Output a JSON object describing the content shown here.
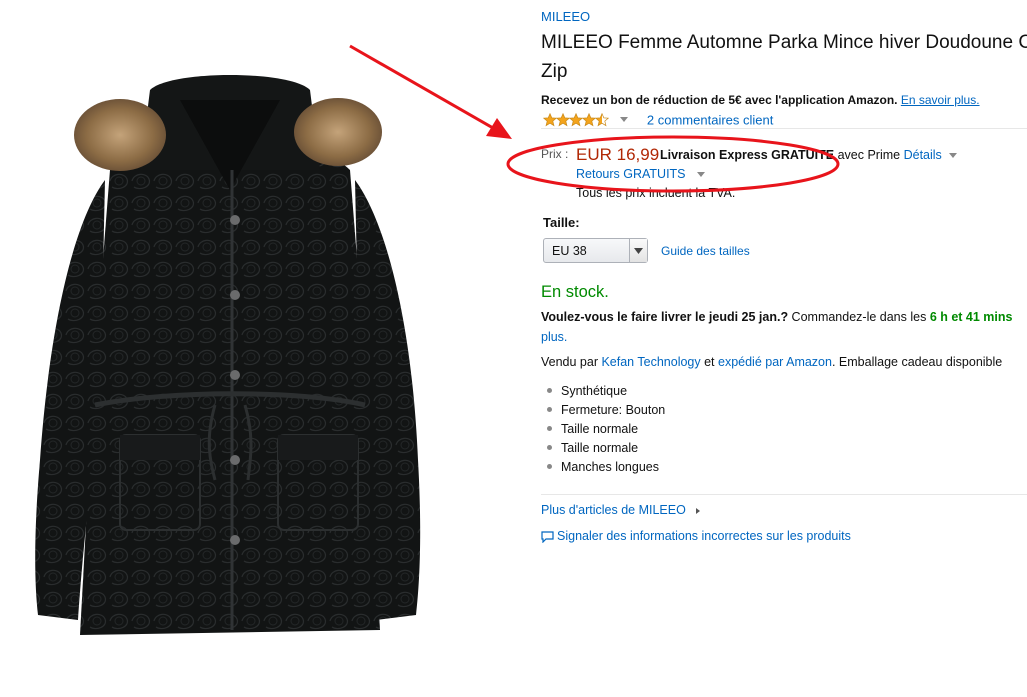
{
  "product": {
    "brand": "MILEEO",
    "title": "MILEEO Femme Automne Parka Mince hiver Doudoune C Zip",
    "promo_text": "Recevez un bon de réduction de 5€ avec l'application Amazon.",
    "promo_link": "En savoir plus.",
    "rating": 4.5,
    "review_count": "2 commentaires client"
  },
  "price": {
    "label": "Prix :",
    "value": "EUR 16,99",
    "shipping_bold": "Livraison Express GRATUITE",
    "shipping_tail": " avec Prime ",
    "details_link": "Détails",
    "returns": "Retours GRATUITS",
    "tva": "Tous les prix incluent la TVA."
  },
  "size": {
    "label": "Taille:",
    "selected": "EU 38",
    "guide_link": "Guide des tailles"
  },
  "availability": {
    "stock": "En stock.",
    "delivery_question": "Voulez-vous le faire livrer le jeudi 25 jan.?",
    "delivery_order": " Commandez-le dans les ",
    "delivery_time": "6 h et 41 mins",
    "more_link": "plus."
  },
  "seller": {
    "prefix": "Vendu par ",
    "seller_name": "Kefan Technology",
    "middle": " et ",
    "shipper": "expédié par Amazon",
    "suffix": ". Emballage cadeau disponible"
  },
  "features": [
    "Synthétique",
    "Fermeture: Bouton",
    "Taille normale",
    "Taille normale",
    "Manches longues"
  ],
  "links": {
    "more_brand": "Plus d'articles de MILEEO",
    "report": "Signaler des informations incorrectes sur les produits"
  },
  "colors": {
    "link": "#0066c0",
    "price": "#b12704",
    "stock": "#008a00",
    "annotation": "#e8141b",
    "star": "#f4a41c"
  },
  "icons": [
    "star-icon",
    "chevron-down-icon",
    "chevron-right-icon",
    "comment-icon",
    "annotation-arrow",
    "annotation-ellipse"
  ]
}
